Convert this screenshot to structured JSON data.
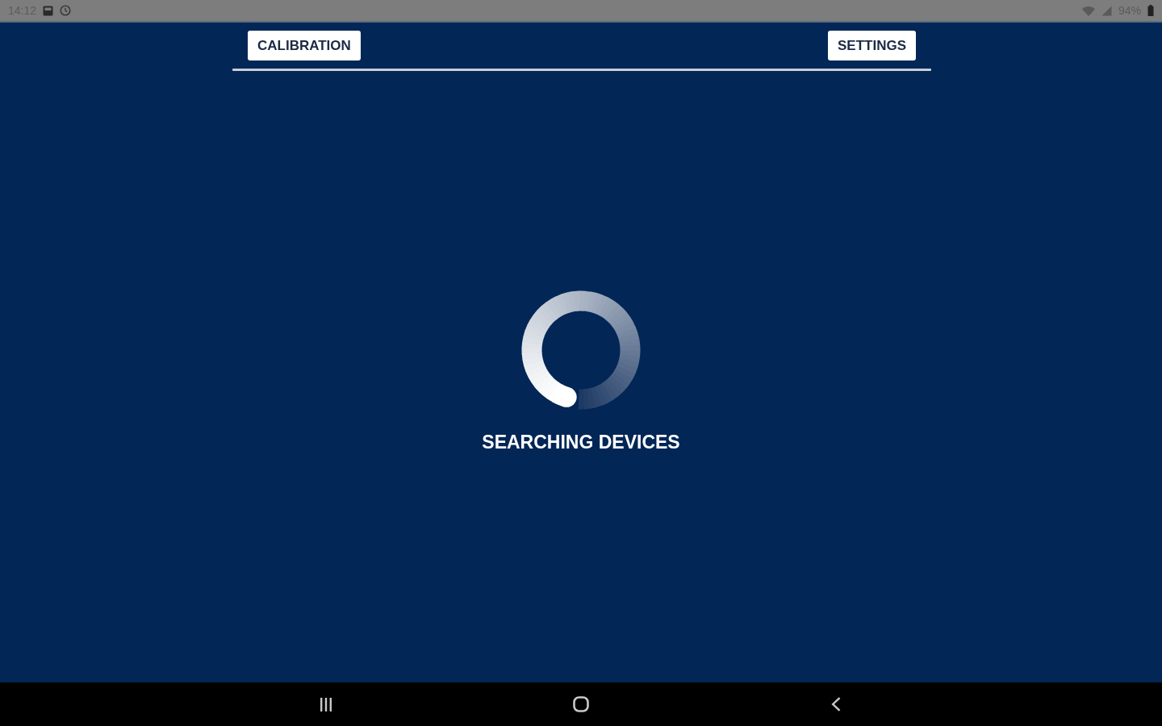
{
  "status_bar": {
    "time": "14:12",
    "battery": "94%"
  },
  "toolbar": {
    "buttons": [
      {
        "label": "CALIBRATION"
      },
      {
        "label": "SETTINGS"
      }
    ]
  },
  "loading": {
    "message": "SEARCHING DEVICES"
  }
}
